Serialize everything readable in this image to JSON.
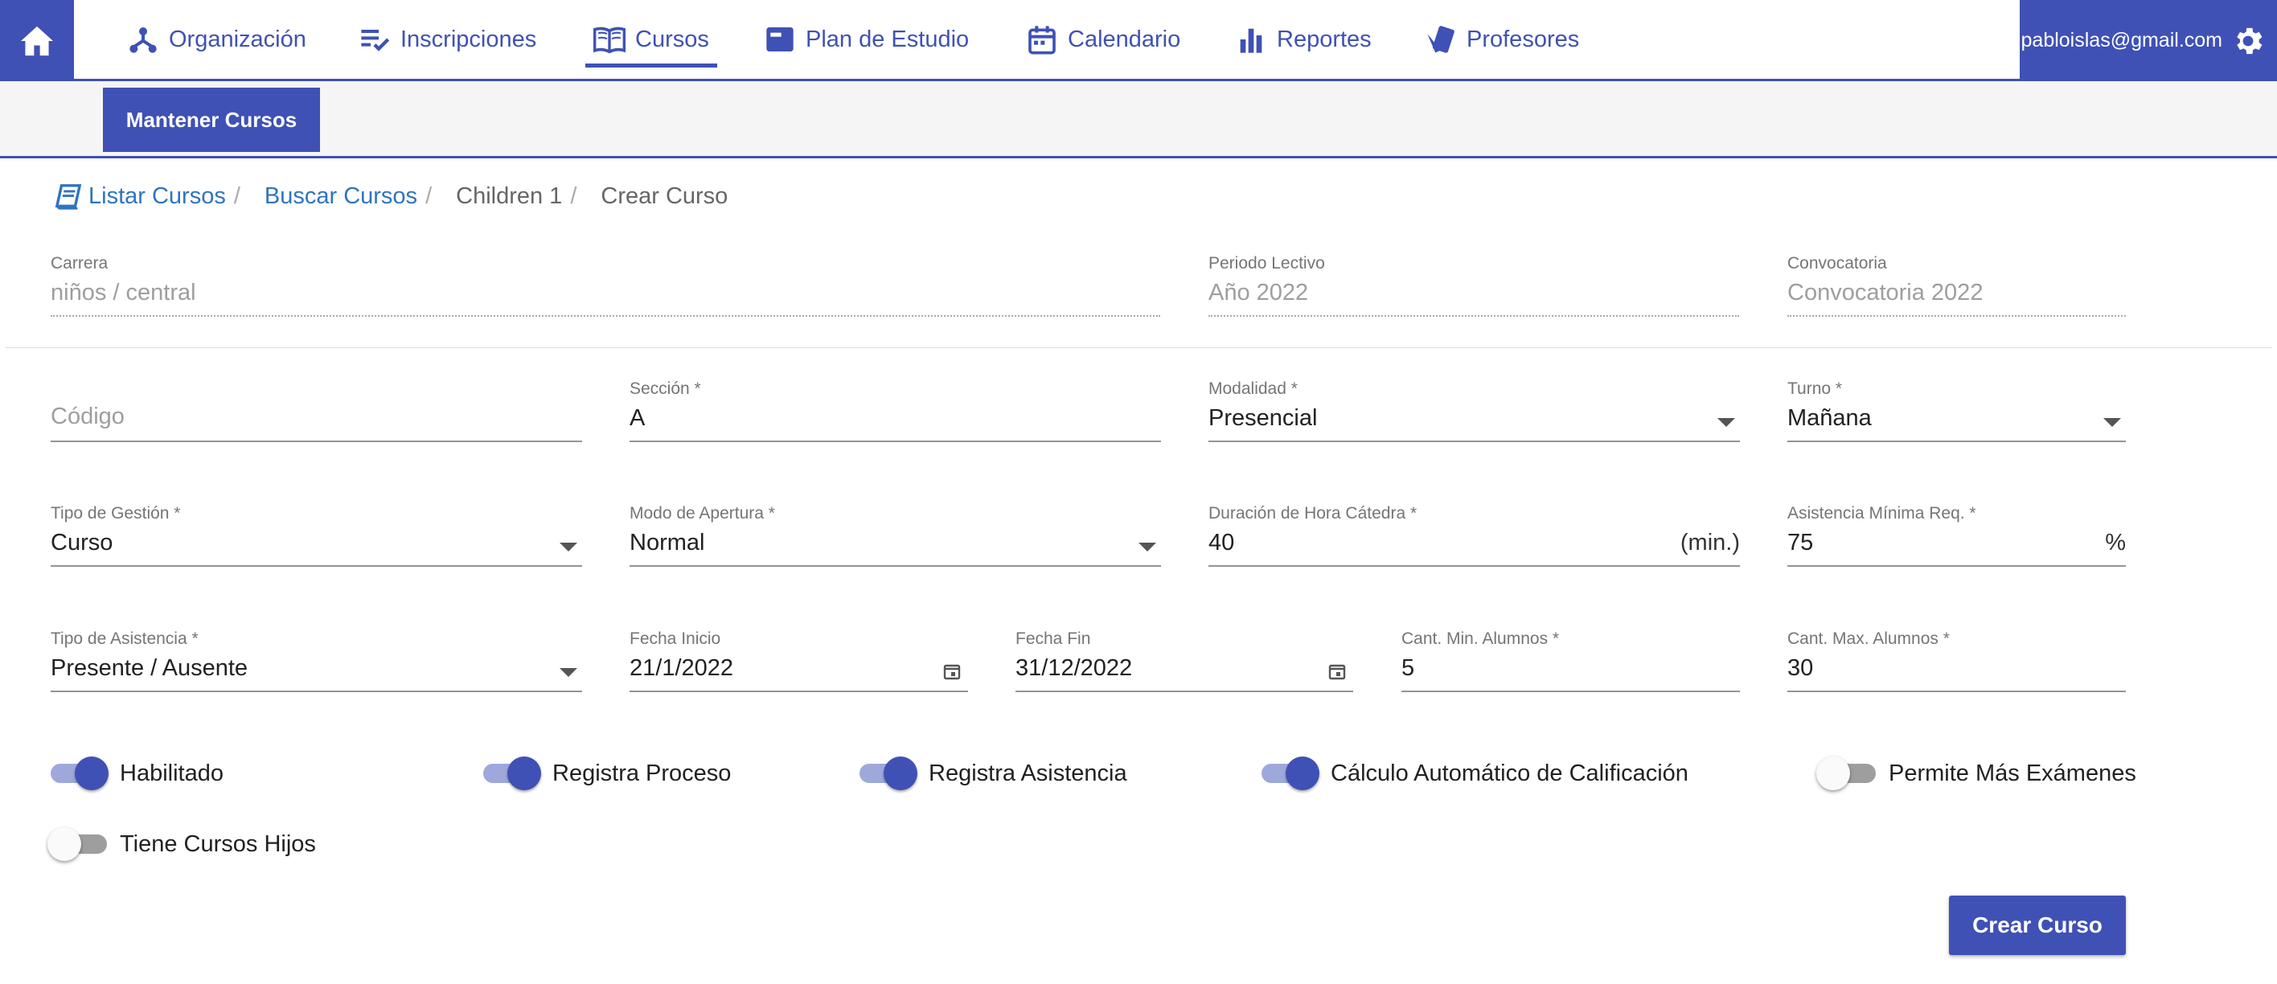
{
  "nav": {
    "items": [
      {
        "label": "Organización",
        "icon": "org-hierarchy-icon"
      },
      {
        "label": "Inscripciones",
        "icon": "playlist-check-icon"
      },
      {
        "label": "Cursos",
        "icon": "book-open-icon",
        "active": true
      },
      {
        "label": "Plan de Estudio",
        "icon": "web-asset-icon"
      },
      {
        "label": "Calendario",
        "icon": "calendar-icon"
      },
      {
        "label": "Reportes",
        "icon": "bar-chart-icon"
      },
      {
        "label": "Profesores",
        "icon": "cards-icon"
      }
    ],
    "user_email": "pabloislas@gmail.com",
    "accent": "#3f51b5"
  },
  "subnav": {
    "button_label": "Mantener Cursos"
  },
  "breadcrumb": {
    "items": [
      "Listar Cursos",
      "Buscar Cursos",
      "Children 1",
      "Crear Curso"
    ],
    "separator": "/"
  },
  "form": {
    "carrera": {
      "label": "Carrera",
      "value": "niños / central"
    },
    "periodo": {
      "label": "Periodo Lectivo",
      "value": "Año 2022"
    },
    "convocatoria": {
      "label": "Convocatoria",
      "value": "Convocatoria 2022"
    },
    "codigo": {
      "placeholder": "Código",
      "value": ""
    },
    "seccion": {
      "label": "Sección *",
      "value": "A"
    },
    "modalidad": {
      "label": "Modalidad *",
      "value": "Presencial"
    },
    "turno": {
      "label": "Turno *",
      "value": "Mañana"
    },
    "tipo_gestion": {
      "label": "Tipo de Gestión *",
      "value": "Curso"
    },
    "modo_apertura": {
      "label": "Modo de Apertura *",
      "value": "Normal"
    },
    "duracion": {
      "label": "Duración de Hora Cátedra *",
      "value": "40",
      "suffix": "(min.)"
    },
    "asistencia_min": {
      "label": "Asistencia Mínima Req. *",
      "value": "75",
      "suffix": "%"
    },
    "tipo_asistencia": {
      "label": "Tipo de Asistencia *",
      "value": "Presente / Ausente"
    },
    "fecha_inicio": {
      "label": "Fecha Inicio",
      "value": "21/1/2022"
    },
    "fecha_fin": {
      "label": "Fecha Fin",
      "value": "31/12/2022"
    },
    "cant_min": {
      "label": "Cant. Min. Alumnos *",
      "value": "5"
    },
    "cant_max": {
      "label": "Cant. Max. Alumnos *",
      "value": "30"
    }
  },
  "switches": [
    {
      "label": "Habilitado",
      "on": true
    },
    {
      "label": "Registra Proceso",
      "on": true
    },
    {
      "label": "Registra Asistencia",
      "on": true
    },
    {
      "label": "Cálculo Automático de Calificación",
      "on": true
    },
    {
      "label": "Permite Más Exámenes",
      "on": false
    },
    {
      "label": "Tiene Cursos Hijos",
      "on": false
    }
  ],
  "actions": {
    "create_label": "Crear Curso"
  }
}
